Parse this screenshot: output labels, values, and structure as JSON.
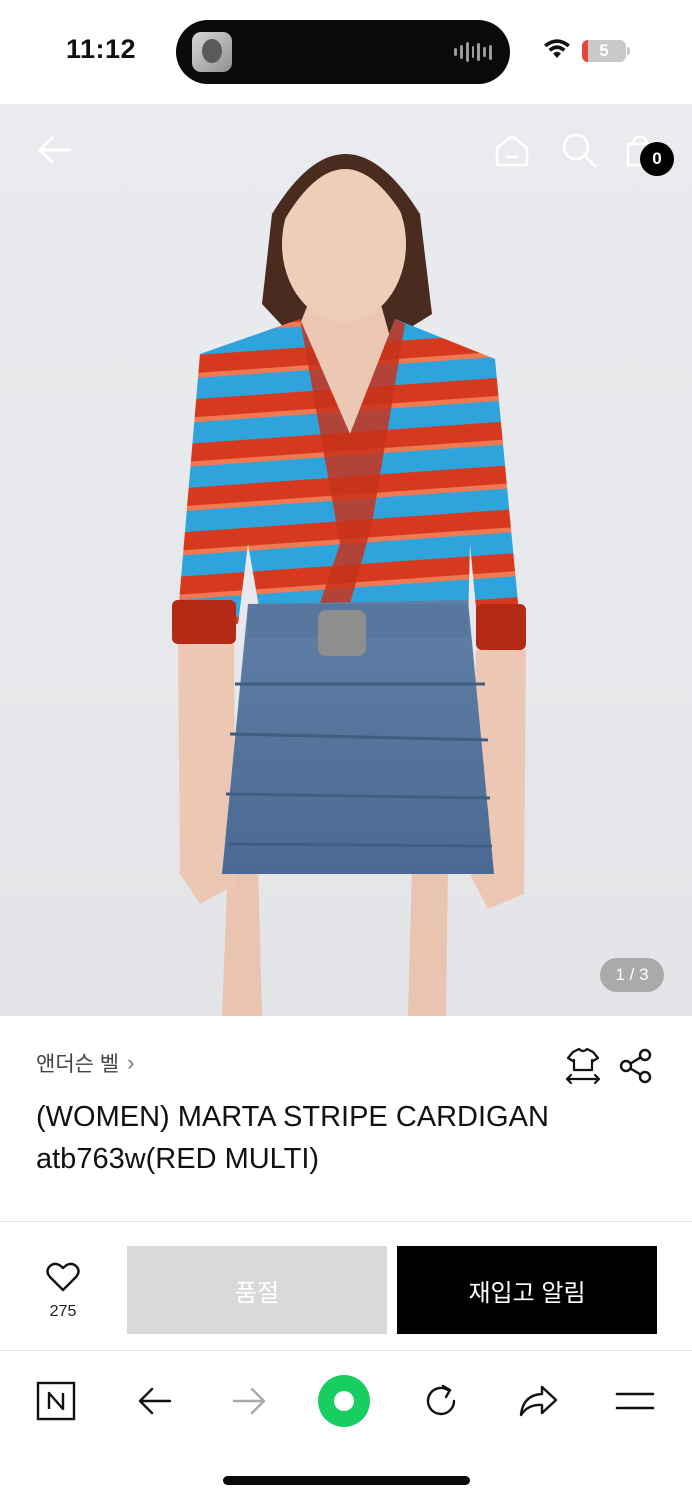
{
  "status_bar": {
    "time": "11:12",
    "battery_level": "5",
    "battery_color": "#e5463b"
  },
  "product": {
    "image_counter": "1 / 3",
    "cart_count": "0",
    "brand": "앤더슨 벨",
    "title_line1": "(WOMEN) MARTA STRIPE CARDIGAN",
    "title_line2": "atb763w(RED MULTI)"
  },
  "actions": {
    "wish_count": "275",
    "soldout_label": "품절",
    "restock_label": "재입고 알림",
    "soldout_color": "#d9d9d9",
    "restock_color": "#000000"
  },
  "icons": {
    "back": "arrow-left-icon",
    "home": "home-icon",
    "search": "search-icon",
    "bag": "shopping-bag-icon",
    "size": "size-guide-icon",
    "share": "share-icon",
    "heart": "heart-icon",
    "naver": "naver-n-icon",
    "browser_back": "arrow-left-icon",
    "browser_forward": "arrow-right-icon",
    "green_dot": "green-dot-icon",
    "reload": "reload-icon",
    "browser_share": "share-arrow-icon",
    "menu": "menu-icon"
  },
  "colors": {
    "accent_green": "#19ce60"
  }
}
